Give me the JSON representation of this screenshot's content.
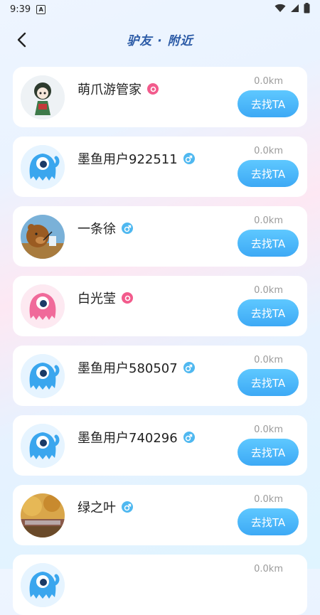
{
  "status_bar": {
    "time": "9:39",
    "notification_letter": "A"
  },
  "header": {
    "title": "驴友 · 附近"
  },
  "users": [
    {
      "name": "萌爪游管家",
      "gender": "female",
      "distance": "0.0km",
      "button": "去找TA",
      "avatar": "girl-figure"
    },
    {
      "name": "墨鱼用户922511",
      "gender": "male",
      "distance": "0.0km",
      "button": "去找TA",
      "avatar": "blue-squid"
    },
    {
      "name": "一条徐",
      "gender": "male",
      "distance": "0.0km",
      "button": "去找TA",
      "avatar": "bear-drinking"
    },
    {
      "name": "白光莹",
      "gender": "female",
      "distance": "0.0km",
      "button": "去找TA",
      "avatar": "pink-squid"
    },
    {
      "name": "墨鱼用户580507",
      "gender": "male",
      "distance": "0.0km",
      "button": "去找TA",
      "avatar": "blue-squid"
    },
    {
      "name": "墨鱼用户740296",
      "gender": "male",
      "distance": "0.0km",
      "button": "去找TA",
      "avatar": "blue-squid"
    },
    {
      "name": "绿之叶",
      "gender": "male",
      "distance": "0.0km",
      "button": "去找TA",
      "avatar": "autumn-scene"
    },
    {
      "name": "",
      "gender": "",
      "distance": "0.0km",
      "button": "",
      "avatar": "blue-squid"
    }
  ],
  "colors": {
    "accent": "#3da9f5",
    "title": "#2b5aa6",
    "male_badge": "#4fb8f0",
    "female_badge": "#f25b8c"
  }
}
